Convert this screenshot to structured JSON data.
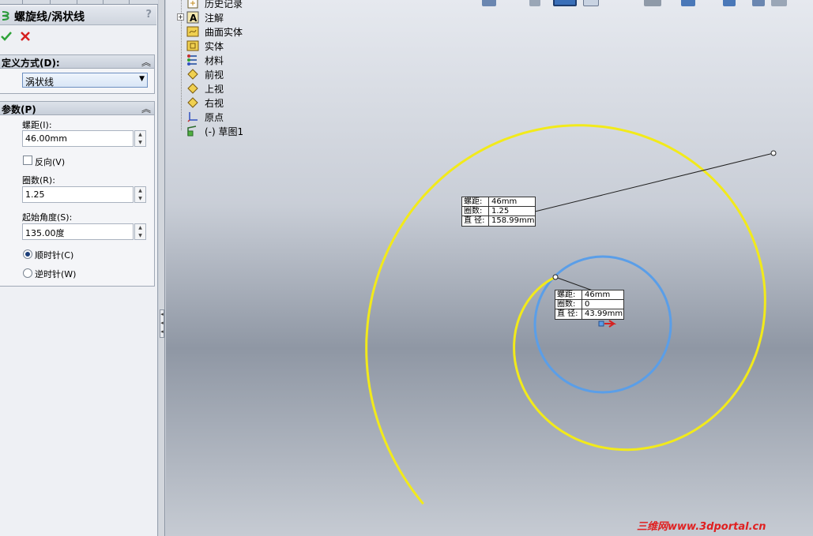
{
  "property_manager": {
    "title": "螺旋线/涡状线",
    "help_label": "?",
    "sections": {
      "definition": {
        "label": "定义方式(D):",
        "selected_value": "涡状线"
      },
      "parameters": {
        "label": "参数(P)",
        "pitch_label": "螺距(I):",
        "pitch_value": "46.00mm",
        "reverse_label": "反向(V)",
        "reverse_checked": false,
        "revolutions_label": "圈数(R):",
        "revolutions_value": "1.25",
        "start_angle_label": "起始角度(S):",
        "start_angle_value": "135.00度",
        "clockwise_label": "顺时针(C)",
        "counterclockwise_label": "逆时针(W)",
        "direction_selected": "clockwise"
      }
    }
  },
  "feature_tree": {
    "items": [
      {
        "label": "历史记录",
        "icon": "history-icon"
      },
      {
        "label": "注解",
        "icon": "annotation-icon"
      },
      {
        "label": "曲面实体",
        "icon": "surface-body-icon"
      },
      {
        "label": "实体",
        "icon": "solid-body-icon"
      },
      {
        "label": "材料",
        "icon": "material-icon"
      },
      {
        "label": "前视",
        "icon": "plane-icon"
      },
      {
        "label": "上视",
        "icon": "plane-icon"
      },
      {
        "label": "右视",
        "icon": "plane-icon"
      },
      {
        "label": "原点",
        "icon": "origin-icon"
      },
      {
        "label": "(-) 草图1",
        "icon": "sketch-icon"
      }
    ]
  },
  "callouts": {
    "outer": {
      "rows": [
        {
          "key": "螺距:",
          "value": "46mm"
        },
        {
          "key": "圈数:",
          "value": "1.25"
        },
        {
          "key": "直 径:",
          "value": "158.99mm"
        }
      ]
    },
    "inner": {
      "rows": [
        {
          "key": "螺距:",
          "value": "46mm"
        },
        {
          "key": "圈数:",
          "value": "0"
        },
        {
          "key": "直 径:",
          "value": "43.99mm"
        }
      ]
    }
  },
  "watermark": "三维网www.3dportal.cn",
  "colors": {
    "spiral": "#f2ea1a",
    "sketch_circle": "#5a9ee8",
    "accent_ok": "#2fa33a",
    "accent_cancel": "#d62020"
  }
}
